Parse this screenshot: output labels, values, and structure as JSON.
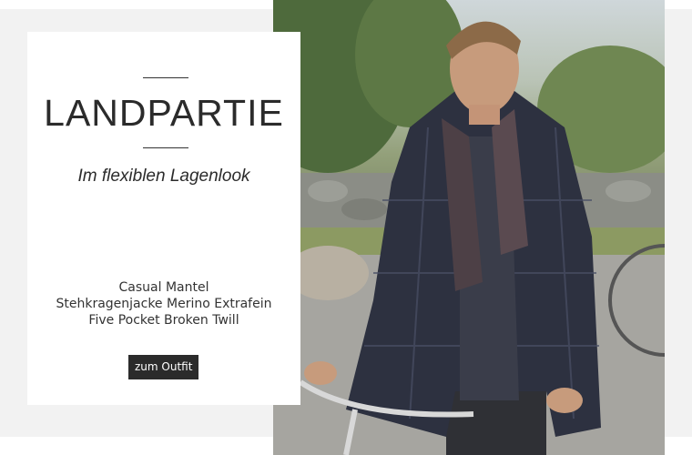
{
  "banner": {
    "title": "LANDPARTIE",
    "subtitle": "Im flexiblen Lagenlook",
    "items": [
      "Casual Mantel",
      "Stehkragenjacke Merino Extrafein",
      "Five Pocket Broken Twill"
    ],
    "cta_label": "zum Outfit"
  },
  "colors": {
    "accent": "#2b2b2b",
    "background": "#f2f2f2"
  }
}
